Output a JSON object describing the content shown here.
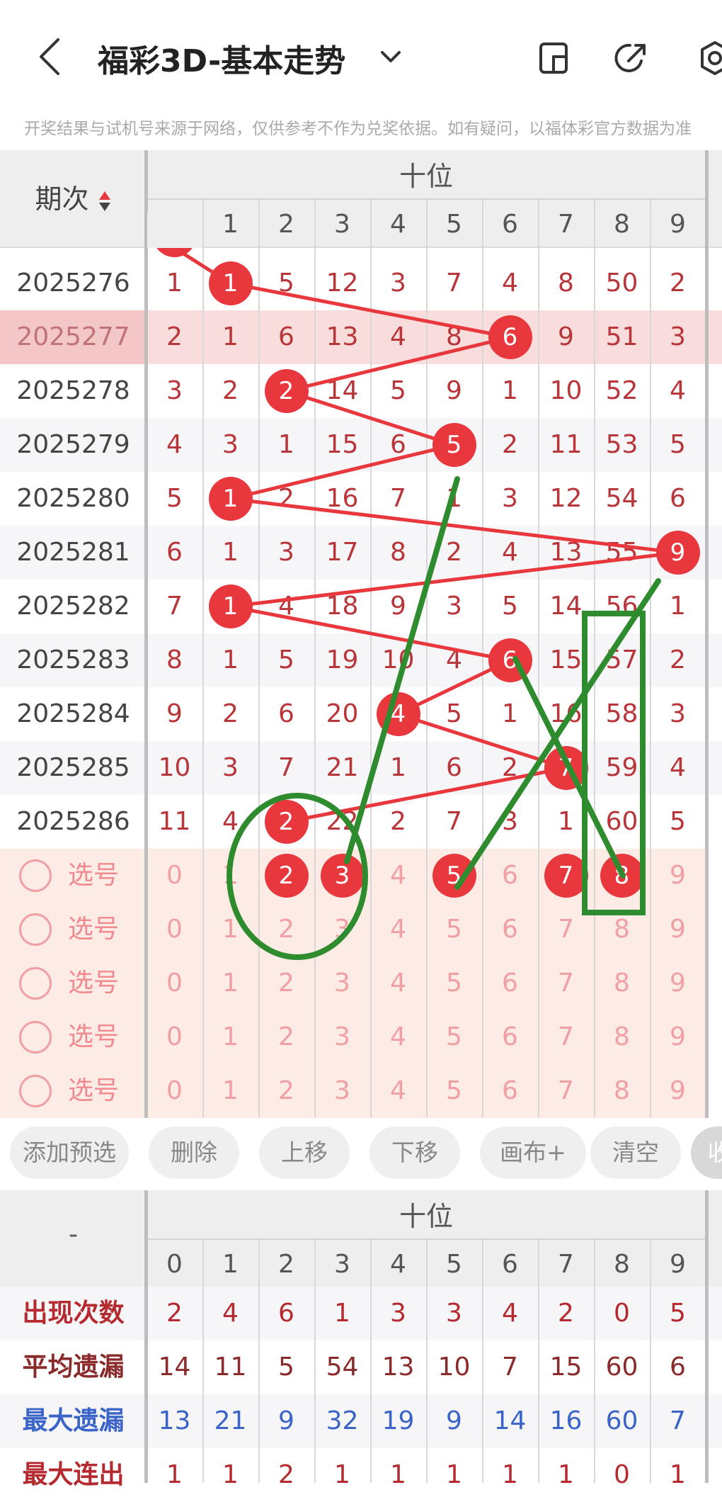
{
  "header": {
    "title": "福彩3D-基本走势",
    "notice": "开奖结果与试机号来源于网络，仅供参考不作为兑奖依据。如有疑问，以福体彩官方数据为准"
  },
  "table": {
    "group_label": "十位",
    "period_header": "期次",
    "digits": [
      "0",
      "1",
      "2",
      "3",
      "4",
      "5",
      "6",
      "7",
      "8",
      "9"
    ],
    "rows": [
      {
        "period": "2025276",
        "cells": [
          "1",
          "1",
          "5",
          "12",
          "3",
          "7",
          "4",
          "8",
          "50",
          "2"
        ],
        "hit": 1
      },
      {
        "period": "2025277",
        "cells": [
          "2",
          "1",
          "6",
          "13",
          "4",
          "8",
          "6",
          "9",
          "51",
          "3"
        ],
        "hit": 6
      },
      {
        "period": "2025278",
        "cells": [
          "3",
          "2",
          "2",
          "14",
          "5",
          "9",
          "1",
          "10",
          "52",
          "4"
        ],
        "hit": 2
      },
      {
        "period": "2025279",
        "cells": [
          "4",
          "3",
          "1",
          "15",
          "6",
          "5",
          "2",
          "11",
          "53",
          "5"
        ],
        "hit": 5
      },
      {
        "period": "2025280",
        "cells": [
          "5",
          "1",
          "2",
          "16",
          "7",
          "1",
          "3",
          "12",
          "54",
          "6"
        ],
        "hit": 1
      },
      {
        "period": "2025281",
        "cells": [
          "6",
          "1",
          "3",
          "17",
          "8",
          "2",
          "4",
          "13",
          "55",
          "9"
        ],
        "hit": 9
      },
      {
        "period": "2025282",
        "cells": [
          "7",
          "1",
          "4",
          "18",
          "9",
          "3",
          "5",
          "14",
          "56",
          "1"
        ],
        "hit": 1
      },
      {
        "period": "2025283",
        "cells": [
          "8",
          "1",
          "5",
          "19",
          "10",
          "4",
          "6",
          "15",
          "57",
          "2"
        ],
        "hit": 6
      },
      {
        "period": "2025284",
        "cells": [
          "9",
          "2",
          "6",
          "20",
          "4",
          "5",
          "1",
          "16",
          "58",
          "3"
        ],
        "hit": 4
      },
      {
        "period": "2025285",
        "cells": [
          "10",
          "3",
          "7",
          "21",
          "1",
          "6",
          "2",
          "7",
          "59",
          "4"
        ],
        "hit": 7
      },
      {
        "period": "2025286",
        "cells": [
          "11",
          "4",
          "2",
          "22",
          "2",
          "7",
          "3",
          "1",
          "60",
          "5"
        ],
        "hit": 2
      }
    ],
    "select_label": "选号",
    "select_rows": [
      {
        "cells": [
          "0",
          "1",
          "2",
          "3",
          "4",
          "5",
          "6",
          "7",
          "8",
          "9"
        ],
        "picked": [
          2,
          3,
          5,
          7,
          8
        ]
      },
      {
        "cells": [
          "0",
          "1",
          "2",
          "3",
          "4",
          "5",
          "6",
          "7",
          "8",
          "9"
        ],
        "picked": []
      },
      {
        "cells": [
          "0",
          "1",
          "2",
          "3",
          "4",
          "5",
          "6",
          "7",
          "8",
          "9"
        ],
        "picked": []
      },
      {
        "cells": [
          "0",
          "1",
          "2",
          "3",
          "4",
          "5",
          "6",
          "7",
          "8",
          "9"
        ],
        "picked": []
      },
      {
        "cells": [
          "0",
          "1",
          "2",
          "3",
          "4",
          "5",
          "6",
          "7",
          "8",
          "9"
        ],
        "picked": []
      }
    ]
  },
  "buttons": [
    "添加预选",
    "删除",
    "上移",
    "下移",
    "画布+",
    "清空",
    "收"
  ],
  "stats": {
    "corner": "-",
    "group_label": "十位",
    "rows": [
      {
        "label": "出现次数",
        "values": [
          "2",
          "4",
          "6",
          "1",
          "3",
          "3",
          "4",
          "2",
          "0",
          "5"
        ],
        "color": "#b52a2f"
      },
      {
        "label": "平均遗漏",
        "values": [
          "14",
          "11",
          "5",
          "54",
          "13",
          "10",
          "7",
          "15",
          "60",
          "6"
        ],
        "color": "#8a2a2a"
      },
      {
        "label": "最大遗漏",
        "values": [
          "13",
          "21",
          "9",
          "32",
          "19",
          "9",
          "14",
          "16",
          "60",
          "7"
        ],
        "color": "#3a64c8"
      },
      {
        "label": "最大连出",
        "values": [
          "1",
          "1",
          "2",
          "1",
          "1",
          "1",
          "1",
          "1",
          "0",
          "1"
        ],
        "color": "#b52a2f"
      }
    ]
  },
  "colors": {
    "accent": "#e8383d",
    "highlight_row": "#f9dcdc",
    "annotation": "#2e8b2e"
  }
}
